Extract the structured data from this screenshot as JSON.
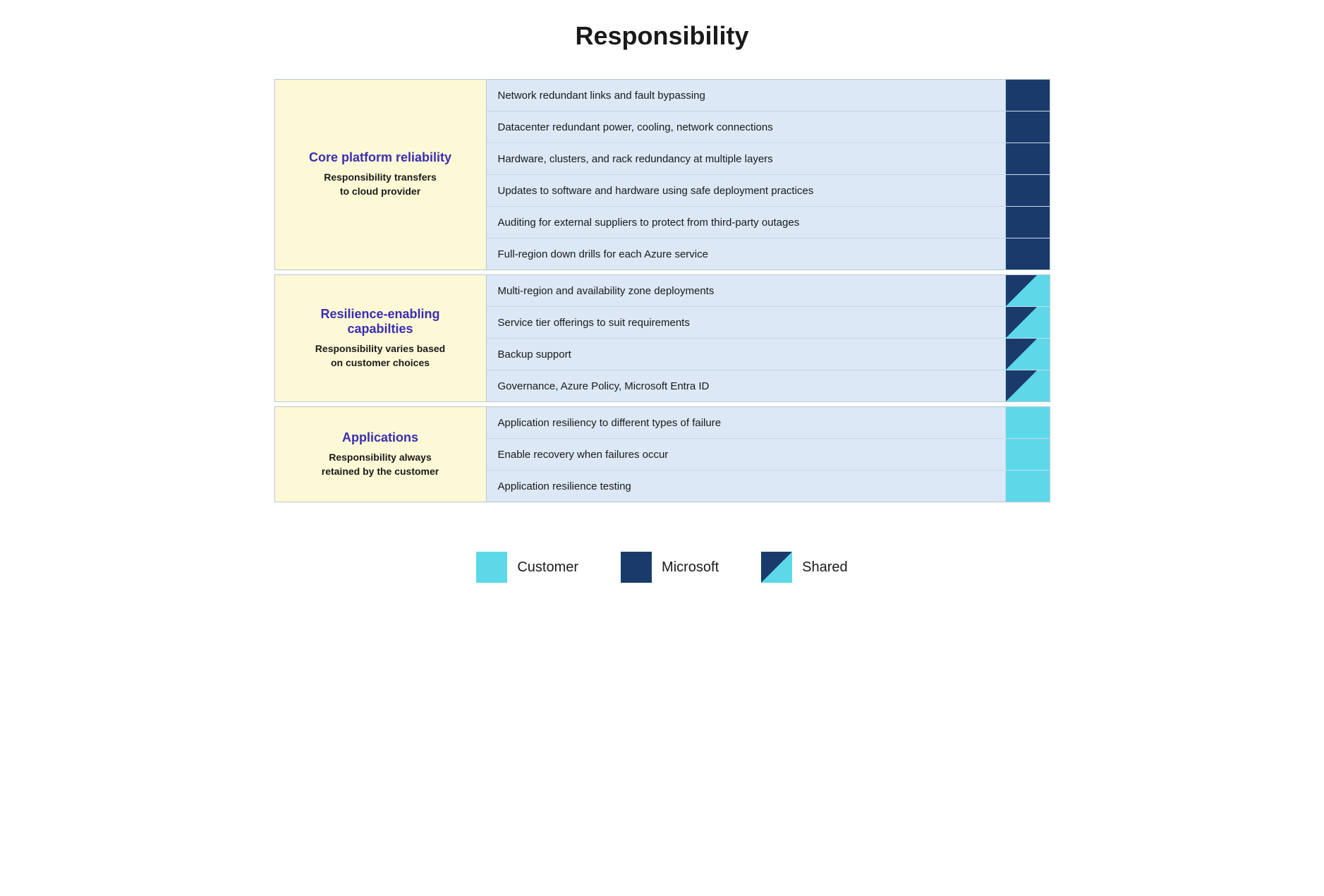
{
  "title": "Responsibility",
  "sections": [
    {
      "id": "core-platform",
      "label_title": "Core platform reliability",
      "label_subtitle": "Responsibility transfers\nto cloud provider",
      "rows": [
        {
          "text": "Network redundant links and fault bypassing",
          "indicator": "microsoft"
        },
        {
          "text": "Datacenter redundant power, cooling, network connections",
          "indicator": "microsoft"
        },
        {
          "text": "Hardware, clusters, and rack redundancy at multiple layers",
          "indicator": "microsoft"
        },
        {
          "text": "Updates to software and hardware using safe deployment practices",
          "indicator": "microsoft"
        },
        {
          "text": "Auditing for external suppliers to protect from third-party outages",
          "indicator": "microsoft"
        },
        {
          "text": "Full-region down drills for each Azure service",
          "indicator": "microsoft"
        }
      ]
    },
    {
      "id": "resilience-enabling",
      "label_title": "Resilience-enabling capabilties",
      "label_subtitle": "Responsibility varies based\non customer choices",
      "rows": [
        {
          "text": "Multi-region and availability zone deployments",
          "indicator": "shared"
        },
        {
          "text": "Service tier offerings to suit requirements",
          "indicator": "shared"
        },
        {
          "text": "Backup support",
          "indicator": "shared"
        },
        {
          "text": "Governance, Azure Policy, Microsoft Entra ID",
          "indicator": "shared"
        }
      ]
    },
    {
      "id": "applications",
      "label_title": "Applications",
      "label_subtitle": "Responsibility always\nretained by the customer",
      "rows": [
        {
          "text": "Application resiliency to different types of failure",
          "indicator": "customer"
        },
        {
          "text": "Enable recovery when failures occur",
          "indicator": "customer"
        },
        {
          "text": "Application resilience testing",
          "indicator": "customer"
        }
      ]
    }
  ],
  "legend": {
    "items": [
      {
        "id": "customer",
        "label": "Customer"
      },
      {
        "id": "microsoft",
        "label": "Microsoft"
      },
      {
        "id": "shared",
        "label": "Shared"
      }
    ]
  }
}
